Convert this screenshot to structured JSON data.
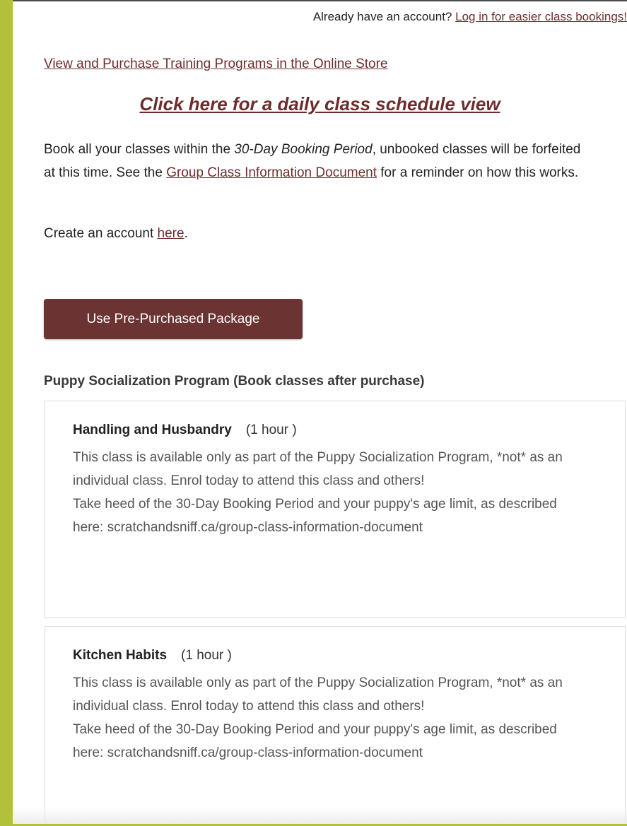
{
  "header": {
    "login_prompt": "Already have an account?",
    "login_link": "Log in for easier class bookings!"
  },
  "store_link": "View and Purchase Training Programs in the Online Store",
  "schedule_link": "Click here for a daily class schedule view",
  "booking_info": {
    "text_before": "Book all your classes within the ",
    "emphasis": "30-Day Booking Period",
    "text_middle": ", unbooked classes will be forfeited at this time. See the ",
    "doc_link": "Group Class Information Document",
    "text_after": " for a reminder on how this works."
  },
  "create_account": {
    "text_before": "Create an account ",
    "link": "here",
    "text_after": "."
  },
  "package_button": "Use Pre-Purchased Package",
  "program": {
    "title": "Puppy Socialization Program (Book classes after purchase)",
    "classes": [
      {
        "name": "Handling and Husbandry",
        "duration": "(1 hour )",
        "desc_1": "This class is available only as part of the Puppy Socialization Program, *not* as an individual class. Enrol today to attend this class and others!",
        "desc_2": "Take heed of the 30-Day Booking Period and your puppy's age limit, as described here: scratchandsniff.ca/group-class-information-document"
      },
      {
        "name": "Kitchen Habits",
        "duration": "(1 hour )",
        "desc_1": "This class is available only as part of the Puppy Socialization Program, *not* as an individual class. Enrol today to attend this class and others!",
        "desc_2": "Take heed of the 30-Day Booking Period and your puppy's age limit, as described here: scratchandsniff.ca/group-class-information-document"
      }
    ]
  },
  "colors": {
    "sidebar_green": "#b3c03a",
    "link_maroon": "#6e2d2d",
    "button_bg": "#6b3332"
  }
}
